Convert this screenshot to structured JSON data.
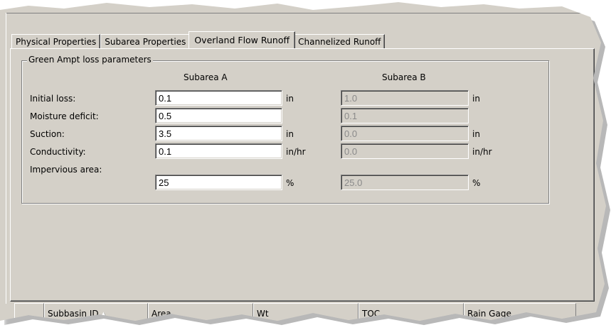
{
  "tabs": [
    {
      "label": "Physical Properties",
      "active": false
    },
    {
      "label": "Subarea Properties",
      "active": false
    },
    {
      "label": "Overland Flow Runoff",
      "active": true
    },
    {
      "label": "Channelized Runoff",
      "active": false
    }
  ],
  "group": {
    "title": "Green Ampt loss parameters",
    "col_a": "Subarea A",
    "col_b": "Subarea B"
  },
  "rows": [
    {
      "label": "Initial loss:",
      "a_value": "0.1",
      "a_unit": "in",
      "b_value": "1.0",
      "b_unit": "in"
    },
    {
      "label": "Moisture deficit:",
      "a_value": "0.5",
      "a_unit": "",
      "b_value": "0.1",
      "b_unit": ""
    },
    {
      "label": "Suction:",
      "a_value": "3.5",
      "a_unit": "in",
      "b_value": "0.0",
      "b_unit": "in"
    },
    {
      "label": "Conductivity:",
      "a_value": "0.1",
      "a_unit": "in/hr",
      "b_value": "0.0",
      "b_unit": "in/hr"
    },
    {
      "label": "Impervious area:",
      "a_value": "25",
      "a_unit": "%",
      "b_value": "25.0",
      "b_unit": "%"
    }
  ],
  "grid_headers": [
    "",
    "Subbasin ID",
    "Area",
    "Wt",
    "TOC",
    "Rain Gage"
  ],
  "sort_icon": "sort-ascending-icon",
  "colors": {
    "face": "#d4d0c8",
    "disabled_text": "#8a8a8a"
  }
}
